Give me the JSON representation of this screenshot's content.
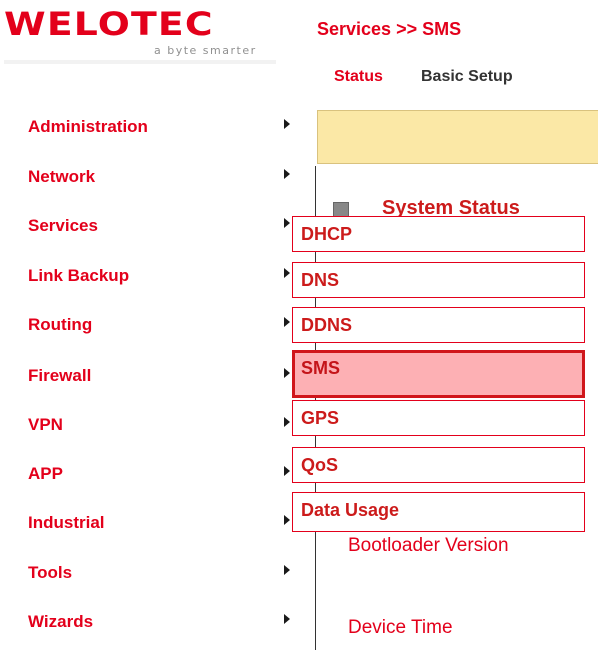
{
  "logo": {
    "wordmark": "WELOTEC",
    "tagline": "a byte smarter"
  },
  "header": {
    "breadcrumb": "Services >> SMS",
    "tabs": [
      "Status",
      "Basic Setup"
    ]
  },
  "sidebar": {
    "items": [
      {
        "label": "Administration"
      },
      {
        "label": "Network"
      },
      {
        "label": "Services"
      },
      {
        "label": "Link Backup"
      },
      {
        "label": "Routing"
      },
      {
        "label": "Firewall"
      },
      {
        "label": "VPN"
      },
      {
        "label": "APP"
      },
      {
        "label": "Industrial"
      },
      {
        "label": "Tools"
      },
      {
        "label": "Wizards"
      }
    ]
  },
  "submenu": {
    "items": [
      "DHCP",
      "DNS",
      "DDNS",
      "SMS",
      "GPS",
      "QoS",
      "Data Usage"
    ],
    "selected": "SMS"
  },
  "content": {
    "section_title": "System Status",
    "fields": [
      "Bootloader Version",
      "Device Time"
    ]
  },
  "colors": {
    "brand_red": "#e3001b",
    "highlight": "#fdb0b4",
    "status_bar": "#fbe8a6"
  }
}
